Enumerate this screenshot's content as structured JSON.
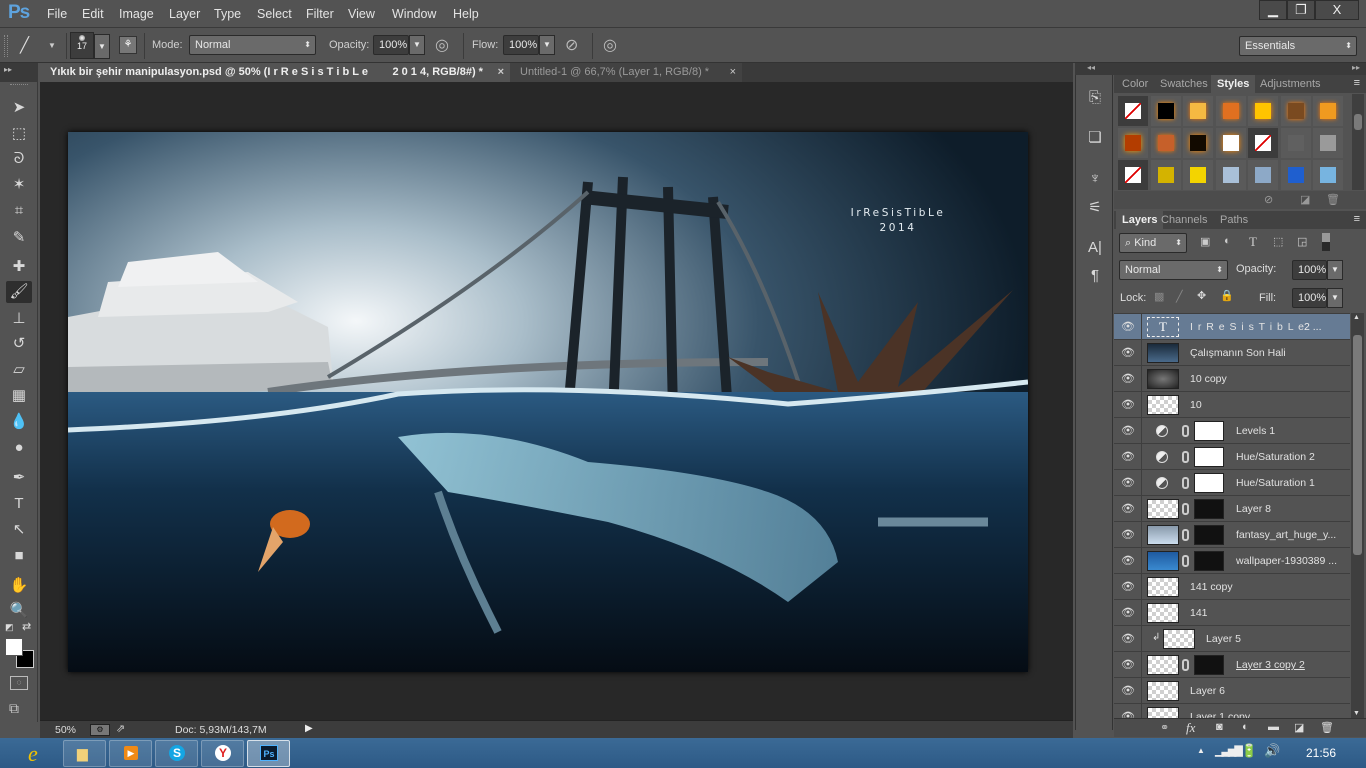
{
  "app": {
    "logo": "Ps",
    "name": "Adobe Photoshop"
  },
  "menu": [
    "File",
    "Edit",
    "Image",
    "Layer",
    "Type",
    "Select",
    "Filter",
    "View",
    "Window",
    "Help"
  ],
  "window_controls": {
    "minimize": "▁",
    "restore": "❐",
    "close": "X"
  },
  "options_bar": {
    "brush_size": "17",
    "mode_label": "Mode:",
    "mode_value": "Normal",
    "opacity_label": "Opacity:",
    "opacity_value": "100%",
    "flow_label": "Flow:",
    "flow_value": "100%",
    "workspace": "Essentials"
  },
  "document_tabs": [
    {
      "title": "Yıkık bir şehir manipulasyon.psd @ 50% (I r R e S i s T i b L e        2 0 1 4, RGB/8#) *",
      "active": true
    },
    {
      "title": "Untitled-1 @ 66,7% (Layer 1, RGB/8) *",
      "active": false
    }
  ],
  "tab_close": "×",
  "artwork": {
    "title_line1": "IrReSisTibLe",
    "title_line2": "2014"
  },
  "tools": [
    {
      "name": "move-tool",
      "glyph": "➤"
    },
    {
      "name": "marquee-tool",
      "glyph": "⬚"
    },
    {
      "name": "lasso-tool",
      "glyph": "ᘐ"
    },
    {
      "name": "magic-wand-tool",
      "glyph": "✶"
    },
    {
      "name": "crop-tool",
      "glyph": "⌗"
    },
    {
      "name": "eyedropper-tool",
      "glyph": "✎"
    },
    {
      "name": "healing-brush-tool",
      "glyph": "✚"
    },
    {
      "name": "brush-tool",
      "glyph": "🖌",
      "active": true
    },
    {
      "name": "clone-stamp-tool",
      "glyph": "⊥"
    },
    {
      "name": "history-brush-tool",
      "glyph": "↺"
    },
    {
      "name": "eraser-tool",
      "glyph": "▱"
    },
    {
      "name": "gradient-tool",
      "glyph": "▦"
    },
    {
      "name": "blur-tool",
      "glyph": "💧"
    },
    {
      "name": "dodge-tool",
      "glyph": "●"
    },
    {
      "name": "pen-tool",
      "glyph": "✒"
    },
    {
      "name": "type-tool",
      "glyph": "T"
    },
    {
      "name": "path-selection-tool",
      "glyph": "↖"
    },
    {
      "name": "rectangle-tool",
      "glyph": "■"
    },
    {
      "name": "hand-tool",
      "glyph": "✋"
    },
    {
      "name": "zoom-tool",
      "glyph": "🔍"
    }
  ],
  "colors": {
    "foreground": "#ffffff",
    "background": "#000000",
    "accent_selected_layer": "#667b94"
  },
  "status_bar": {
    "zoom": "50%",
    "doc": "Doc: 5,93M/143,7M"
  },
  "styles_panel": {
    "tabs": [
      "Color",
      "Swatches",
      "Styles",
      "Adjustments"
    ],
    "active_tab": "Styles"
  },
  "layers_panel": {
    "tabs": [
      "Layers",
      "Channels",
      "Paths"
    ],
    "active_tab": "Layers",
    "filter": "Kind",
    "blend_mode": "Normal",
    "opacity_label": "Opacity:",
    "opacity": "100%",
    "lock_label": "Lock:",
    "fill_label": "Fill:",
    "fill": "100%",
    "layers": [
      {
        "name": "I r R e S i s T i b L e",
        "suffix": "2 ...",
        "type": "text",
        "selected": true
      },
      {
        "name": "Çalışmanın Son Hali",
        "type": "image"
      },
      {
        "name": "10 copy",
        "type": "image"
      },
      {
        "name": "10",
        "type": "image"
      },
      {
        "name": "Levels 1",
        "type": "adjustment"
      },
      {
        "name": "Hue/Saturation 2",
        "type": "adjustment"
      },
      {
        "name": "Hue/Saturation 1",
        "type": "adjustment"
      },
      {
        "name": "Layer 8",
        "type": "masked"
      },
      {
        "name": "fantasy_art_huge_y...",
        "type": "masked"
      },
      {
        "name": "wallpaper-1930389 ...",
        "type": "masked"
      },
      {
        "name": "141 copy",
        "type": "image"
      },
      {
        "name": "141",
        "type": "image"
      },
      {
        "name": "Layer 5",
        "type": "clipped"
      },
      {
        "name": "Layer 3 copy 2",
        "type": "masked"
      },
      {
        "name": "Layer 6",
        "type": "image"
      },
      {
        "name": "Layer 1 copy",
        "type": "image"
      }
    ],
    "footer_icons": [
      "link-icon",
      "fx-icon",
      "mask-icon",
      "adjustment-icon",
      "folder-icon",
      "new-layer-icon",
      "trash-icon"
    ]
  },
  "taskbar": {
    "apps": [
      {
        "name": "internet-explorer",
        "glyph": "e"
      },
      {
        "name": "file-explorer",
        "glyph": "📁"
      },
      {
        "name": "media-player",
        "glyph": "▶"
      },
      {
        "name": "skype",
        "glyph": "S"
      },
      {
        "name": "yandex-browser",
        "glyph": "Y"
      },
      {
        "name": "photoshop",
        "glyph": "Ps",
        "active": true
      }
    ],
    "clock": "21:56"
  }
}
